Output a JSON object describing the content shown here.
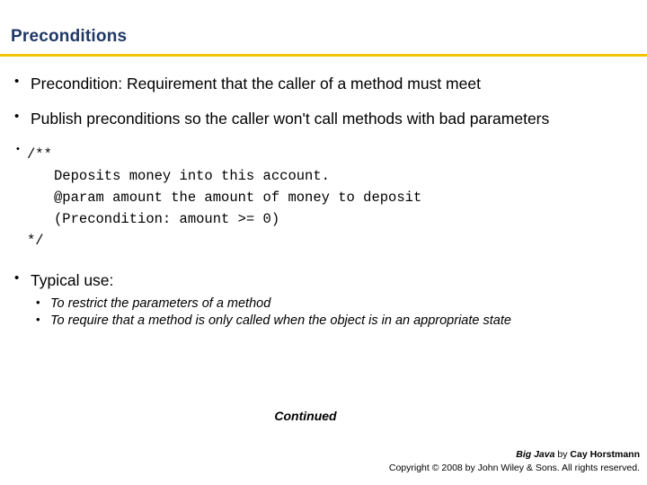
{
  "slide": {
    "title": "Preconditions",
    "accent_color": "#f5c400",
    "title_color": "#1f3864",
    "bullets": [
      "Precondition: Requirement that the caller of a method must meet",
      "Publish preconditions so the caller won't call methods with bad parameters"
    ],
    "code": {
      "lines": [
        "/**",
        "Deposits money into this account.",
        "@param amount the amount of money to deposit",
        "(Precondition: amount >= 0)",
        "*/"
      ]
    },
    "typical_use": {
      "heading": "Typical use:",
      "items": [
        "To restrict the parameters of a method",
        "To require that a method is only called when the object is in an appropriate state"
      ]
    },
    "continued_label": "Continued",
    "footer": {
      "book": "Big Java",
      "by": " by ",
      "author": "Cay Horstmann",
      "copyright": "Copyright © 2008 by John Wiley & Sons.  All rights reserved."
    }
  }
}
